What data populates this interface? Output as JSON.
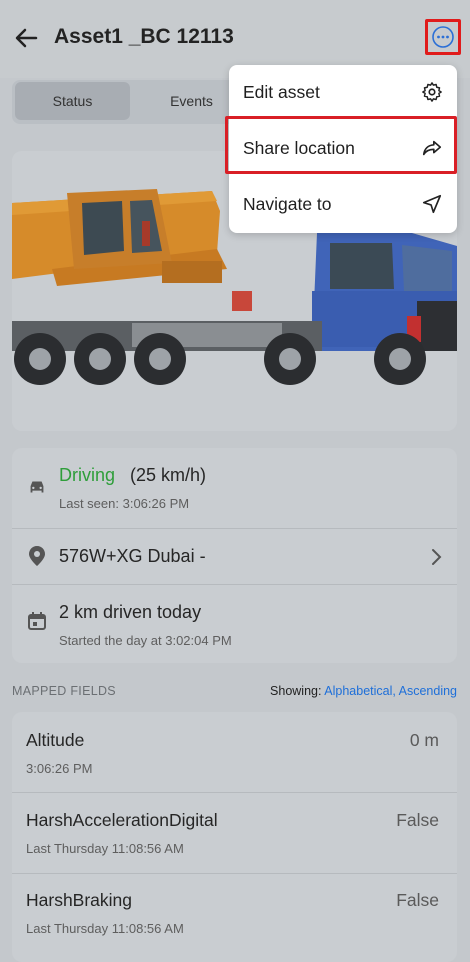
{
  "header": {
    "title": "Asset1 _BC 12113"
  },
  "tabs": [
    {
      "label": "Status"
    },
    {
      "label": "Events"
    }
  ],
  "status": {
    "driving_label": "Driving",
    "speed": "(25 km/h)",
    "last_seen": "Last seen: 3:06:26 PM",
    "location": "576W+XG Dubai -",
    "distance": "2 km driven today",
    "day_start": "Started the day at 3:02:04 PM",
    "driving_color": "#2e9e3a"
  },
  "mapped": {
    "label": "MAPPED FIELDS",
    "showing_label": "Showing:",
    "sort_value": "Alphabetical, Ascending",
    "sort_color": "#1e6fd9"
  },
  "fields": [
    {
      "name": "Altitude",
      "value": "0 m",
      "time": "3:06:26 PM"
    },
    {
      "name": "HarshAccelerationDigital",
      "value": "False",
      "time": "Last Thursday 11:08:56 AM"
    },
    {
      "name": "HarshBraking",
      "value": "False",
      "time": "Last Thursday 11:08:56 AM"
    }
  ],
  "menu": {
    "items": [
      {
        "label": "Edit asset",
        "icon": "gear-icon"
      },
      {
        "label": "Share location",
        "icon": "share-icon"
      },
      {
        "label": "Navigate to",
        "icon": "navigate-icon"
      }
    ]
  }
}
